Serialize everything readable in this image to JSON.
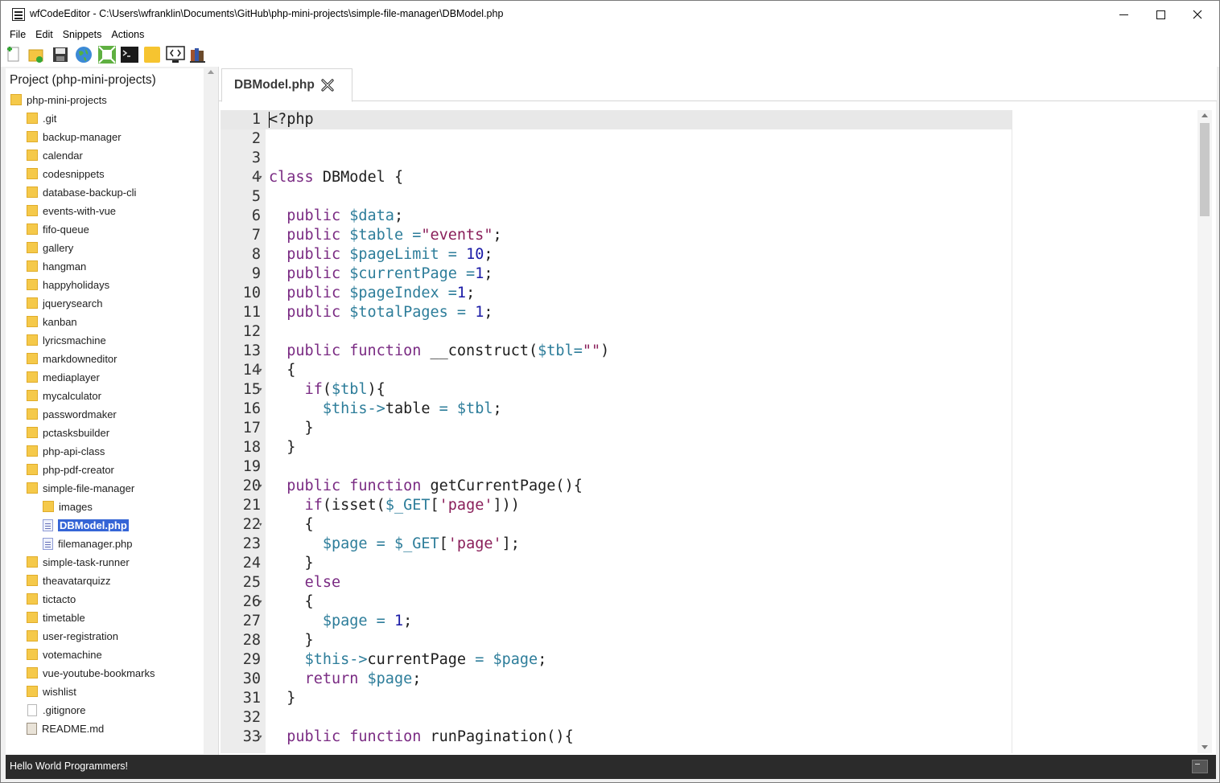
{
  "window": {
    "title": "wfCodeEditor - C:\\Users\\wfranklin\\Documents\\GitHub\\php-mini-projects\\simple-file-manager\\DBModel.php"
  },
  "menu": {
    "items": [
      "File",
      "Edit",
      "Snippets",
      "Actions"
    ]
  },
  "toolbar": {
    "icons": [
      "new-file-icon",
      "new-folder-icon",
      "save-icon",
      "globe-icon",
      "expand-icon",
      "terminal-icon",
      "note-icon",
      "code-view-icon",
      "books-icon"
    ]
  },
  "sidebar": {
    "project_title": "Project (php-mini-projects)",
    "root": "php-mini-projects",
    "items": [
      {
        "label": ".git",
        "type": "folder",
        "level": 1
      },
      {
        "label": "backup-manager",
        "type": "folder",
        "level": 1
      },
      {
        "label": "calendar",
        "type": "folder",
        "level": 1
      },
      {
        "label": "codesnippets",
        "type": "folder",
        "level": 1
      },
      {
        "label": "database-backup-cli",
        "type": "folder",
        "level": 1
      },
      {
        "label": "events-with-vue",
        "type": "folder",
        "level": 1
      },
      {
        "label": "fifo-queue",
        "type": "folder",
        "level": 1
      },
      {
        "label": "gallery",
        "type": "folder",
        "level": 1
      },
      {
        "label": "hangman",
        "type": "folder",
        "level": 1
      },
      {
        "label": "happyholidays",
        "type": "folder",
        "level": 1
      },
      {
        "label": "jquerysearch",
        "type": "folder",
        "level": 1
      },
      {
        "label": "kanban",
        "type": "folder",
        "level": 1
      },
      {
        "label": "lyricsmachine",
        "type": "folder",
        "level": 1
      },
      {
        "label": "markdowneditor",
        "type": "folder",
        "level": 1
      },
      {
        "label": "mediaplayer",
        "type": "folder",
        "level": 1
      },
      {
        "label": "mycalculator",
        "type": "folder",
        "level": 1
      },
      {
        "label": "passwordmaker",
        "type": "folder",
        "level": 1
      },
      {
        "label": "pctasksbuilder",
        "type": "folder",
        "level": 1
      },
      {
        "label": "php-api-class",
        "type": "folder",
        "level": 1
      },
      {
        "label": "php-pdf-creator",
        "type": "folder",
        "level": 1
      },
      {
        "label": "simple-file-manager",
        "type": "folder",
        "level": 1
      },
      {
        "label": "images",
        "type": "folder",
        "level": 2
      },
      {
        "label": "DBModel.php",
        "type": "php",
        "level": 2,
        "selected": true
      },
      {
        "label": "filemanager.php",
        "type": "php",
        "level": 2
      },
      {
        "label": "simple-task-runner",
        "type": "folder",
        "level": 1
      },
      {
        "label": "theavatarquizz",
        "type": "folder",
        "level": 1
      },
      {
        "label": "tictacto",
        "type": "folder",
        "level": 1
      },
      {
        "label": "timetable",
        "type": "folder",
        "level": 1
      },
      {
        "label": "user-registration",
        "type": "folder",
        "level": 1
      },
      {
        "label": "votemachine",
        "type": "folder",
        "level": 1
      },
      {
        "label": "vue-youtube-bookmarks",
        "type": "folder",
        "level": 1
      },
      {
        "label": "wishlist",
        "type": "folder",
        "level": 1
      },
      {
        "label": ".gitignore",
        "type": "file",
        "level": 1
      },
      {
        "label": "README.md",
        "type": "md",
        "level": 1
      }
    ]
  },
  "editor": {
    "tab_label": "DBModel.php",
    "lines": [
      {
        "n": "1",
        "fold": false,
        "tokens": [
          [
            "p",
            "<?php"
          ]
        ]
      },
      {
        "n": "2",
        "fold": false,
        "tokens": []
      },
      {
        "n": "3",
        "fold": false,
        "tokens": []
      },
      {
        "n": "4",
        "fold": true,
        "tokens": [
          [
            "kw",
            "class"
          ],
          [
            "p",
            " DBModel {"
          ]
        ]
      },
      {
        "n": "5",
        "fold": false,
        "tokens": []
      },
      {
        "n": "6",
        "fold": false,
        "tokens": [
          [
            "p",
            "  "
          ],
          [
            "kw",
            "public"
          ],
          [
            "p",
            " "
          ],
          [
            "var",
            "$data"
          ],
          [
            "p",
            ";"
          ]
        ]
      },
      {
        "n": "7",
        "fold": false,
        "tokens": [
          [
            "p",
            "  "
          ],
          [
            "kw",
            "public"
          ],
          [
            "p",
            " "
          ],
          [
            "var",
            "$table"
          ],
          [
            "p",
            " "
          ],
          [
            "op",
            "="
          ],
          [
            "str",
            "\"events\""
          ],
          [
            "p",
            ";"
          ]
        ]
      },
      {
        "n": "8",
        "fold": false,
        "tokens": [
          [
            "p",
            "  "
          ],
          [
            "kw",
            "public"
          ],
          [
            "p",
            " "
          ],
          [
            "var",
            "$pageLimit"
          ],
          [
            "p",
            " "
          ],
          [
            "op",
            "="
          ],
          [
            "p",
            " "
          ],
          [
            "num",
            "10"
          ],
          [
            "p",
            ";"
          ]
        ]
      },
      {
        "n": "9",
        "fold": false,
        "tokens": [
          [
            "p",
            "  "
          ],
          [
            "kw",
            "public"
          ],
          [
            "p",
            " "
          ],
          [
            "var",
            "$currentPage"
          ],
          [
            "p",
            " "
          ],
          [
            "op",
            "="
          ],
          [
            "num",
            "1"
          ],
          [
            "p",
            ";"
          ]
        ]
      },
      {
        "n": "10",
        "fold": false,
        "tokens": [
          [
            "p",
            "  "
          ],
          [
            "kw",
            "public"
          ],
          [
            "p",
            " "
          ],
          [
            "var",
            "$pageIndex"
          ],
          [
            "p",
            " "
          ],
          [
            "op",
            "="
          ],
          [
            "num",
            "1"
          ],
          [
            "p",
            ";"
          ]
        ]
      },
      {
        "n": "11",
        "fold": false,
        "tokens": [
          [
            "p",
            "  "
          ],
          [
            "kw",
            "public"
          ],
          [
            "p",
            " "
          ],
          [
            "var",
            "$totalPages"
          ],
          [
            "p",
            " "
          ],
          [
            "op",
            "="
          ],
          [
            "p",
            " "
          ],
          [
            "num",
            "1"
          ],
          [
            "p",
            ";"
          ]
        ]
      },
      {
        "n": "12",
        "fold": false,
        "tokens": []
      },
      {
        "n": "13",
        "fold": false,
        "tokens": [
          [
            "p",
            "  "
          ],
          [
            "kw",
            "public"
          ],
          [
            "p",
            " "
          ],
          [
            "kw",
            "function"
          ],
          [
            "p",
            " __construct("
          ],
          [
            "var",
            "$tbl"
          ],
          [
            "op",
            "="
          ],
          [
            "str",
            "\"\""
          ],
          [
            "p",
            ")"
          ]
        ]
      },
      {
        "n": "14",
        "fold": true,
        "tokens": [
          [
            "p",
            "  {"
          ]
        ]
      },
      {
        "n": "15",
        "fold": true,
        "tokens": [
          [
            "p",
            "    "
          ],
          [
            "kw",
            "if"
          ],
          [
            "p",
            "("
          ],
          [
            "var",
            "$tbl"
          ],
          [
            "p",
            "){"
          ]
        ]
      },
      {
        "n": "16",
        "fold": false,
        "tokens": [
          [
            "p",
            "      "
          ],
          [
            "var",
            "$this"
          ],
          [
            "op",
            "->"
          ],
          [
            "p",
            "table "
          ],
          [
            "op",
            "="
          ],
          [
            "p",
            " "
          ],
          [
            "var",
            "$tbl"
          ],
          [
            "p",
            ";"
          ]
        ]
      },
      {
        "n": "17",
        "fold": false,
        "tokens": [
          [
            "p",
            "    }"
          ]
        ]
      },
      {
        "n": "18",
        "fold": false,
        "tokens": [
          [
            "p",
            "  }"
          ]
        ]
      },
      {
        "n": "19",
        "fold": false,
        "tokens": []
      },
      {
        "n": "20",
        "fold": true,
        "tokens": [
          [
            "p",
            "  "
          ],
          [
            "kw",
            "public"
          ],
          [
            "p",
            " "
          ],
          [
            "kw",
            "function"
          ],
          [
            "p",
            " getCurrentPage(){"
          ]
        ]
      },
      {
        "n": "21",
        "fold": false,
        "tokens": [
          [
            "p",
            "    "
          ],
          [
            "kw",
            "if"
          ],
          [
            "p",
            "(isset("
          ],
          [
            "var",
            "$_GET"
          ],
          [
            "p",
            "["
          ],
          [
            "str",
            "'page'"
          ],
          [
            "p",
            "]))"
          ]
        ]
      },
      {
        "n": "22",
        "fold": true,
        "tokens": [
          [
            "p",
            "    {"
          ]
        ]
      },
      {
        "n": "23",
        "fold": false,
        "tokens": [
          [
            "p",
            "      "
          ],
          [
            "var",
            "$page"
          ],
          [
            "p",
            " "
          ],
          [
            "op",
            "="
          ],
          [
            "p",
            " "
          ],
          [
            "var",
            "$_GET"
          ],
          [
            "p",
            "["
          ],
          [
            "str",
            "'page'"
          ],
          [
            "p",
            "];"
          ]
        ]
      },
      {
        "n": "24",
        "fold": false,
        "tokens": [
          [
            "p",
            "    }"
          ]
        ]
      },
      {
        "n": "25",
        "fold": false,
        "tokens": [
          [
            "p",
            "    "
          ],
          [
            "kw",
            "else"
          ]
        ]
      },
      {
        "n": "26",
        "fold": true,
        "tokens": [
          [
            "p",
            "    {"
          ]
        ]
      },
      {
        "n": "27",
        "fold": false,
        "tokens": [
          [
            "p",
            "      "
          ],
          [
            "var",
            "$page"
          ],
          [
            "p",
            " "
          ],
          [
            "op",
            "="
          ],
          [
            "p",
            " "
          ],
          [
            "num",
            "1"
          ],
          [
            "p",
            ";"
          ]
        ]
      },
      {
        "n": "28",
        "fold": false,
        "tokens": [
          [
            "p",
            "    }"
          ]
        ]
      },
      {
        "n": "29",
        "fold": false,
        "tokens": [
          [
            "p",
            "    "
          ],
          [
            "var",
            "$this"
          ],
          [
            "op",
            "->"
          ],
          [
            "p",
            "currentPage "
          ],
          [
            "op",
            "="
          ],
          [
            "p",
            " "
          ],
          [
            "var",
            "$page"
          ],
          [
            "p",
            ";"
          ]
        ]
      },
      {
        "n": "30",
        "fold": false,
        "tokens": [
          [
            "p",
            "    "
          ],
          [
            "kw",
            "return"
          ],
          [
            "p",
            " "
          ],
          [
            "var",
            "$page"
          ],
          [
            "p",
            ";"
          ]
        ]
      },
      {
        "n": "31",
        "fold": false,
        "tokens": [
          [
            "p",
            "  }"
          ]
        ]
      },
      {
        "n": "32",
        "fold": false,
        "tokens": []
      },
      {
        "n": "33",
        "fold": true,
        "tokens": [
          [
            "p",
            "  "
          ],
          [
            "kw",
            "public"
          ],
          [
            "p",
            " "
          ],
          [
            "kw",
            "function"
          ],
          [
            "p",
            " runPagination(){"
          ]
        ]
      }
    ]
  },
  "status": {
    "text": "Hello World Programmers!"
  },
  "colors": {
    "keyword": "#7a2b83",
    "variable": "#2d7d9a",
    "number": "#1a1aa6",
    "string": "#8a1f5a",
    "selection": "#3565d6",
    "statusbar": "#2b2b2b"
  }
}
